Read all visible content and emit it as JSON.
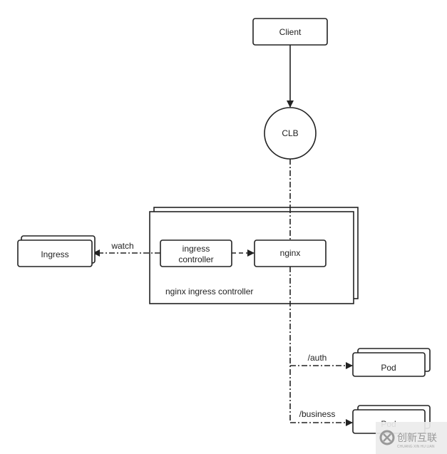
{
  "nodes": {
    "client": "Client",
    "clb": "CLB",
    "ingress": "Ingress",
    "ingress_controller": [
      "ingress",
      "controller"
    ],
    "nginx": "nginx",
    "group_label": "nginx ingress controller",
    "pod_auth": "Pod",
    "pod_business": "Pod"
  },
  "edges": {
    "watch": "watch",
    "auth": "/auth",
    "business": "/business"
  },
  "watermark": {
    "title": "创新互联",
    "subtitle": "CHUANG XIN HU LIAN"
  }
}
